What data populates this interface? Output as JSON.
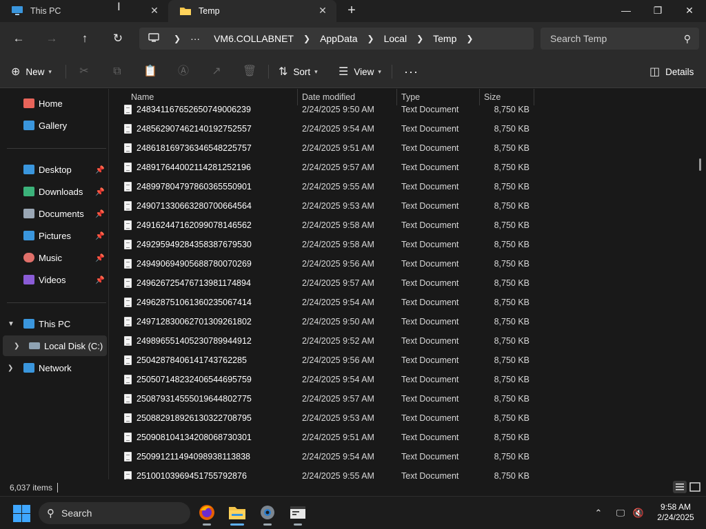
{
  "tabs": [
    {
      "label": "This PC",
      "active": false
    },
    {
      "label": "Temp",
      "active": true
    }
  ],
  "nav": {
    "breadcrumb": [
      "···",
      "VM6.COLLABNET",
      "AppData",
      "Local",
      "Temp"
    ],
    "search_placeholder": "Search Temp"
  },
  "commands": {
    "new_label": "New",
    "sort_label": "Sort",
    "view_label": "View",
    "more_label": "···",
    "details_label": "Details"
  },
  "sidebar": {
    "quick": [
      {
        "label": "Home",
        "icon": "home-icon",
        "color": "#e8645a"
      },
      {
        "label": "Gallery",
        "icon": "gallery-icon",
        "color": "#3a96dd"
      }
    ],
    "pinned": [
      {
        "label": "Desktop",
        "icon": "desktop-icon",
        "color": "#3a96dd"
      },
      {
        "label": "Downloads",
        "icon": "downloads-icon",
        "color": "#3bb27a"
      },
      {
        "label": "Documents",
        "icon": "documents-icon",
        "color": "#9aa7b5"
      },
      {
        "label": "Pictures",
        "icon": "pictures-icon",
        "color": "#3a96dd"
      },
      {
        "label": "Music",
        "icon": "music-icon",
        "color": "#e0706a"
      },
      {
        "label": "Videos",
        "icon": "videos-icon",
        "color": "#8a5cd6"
      }
    ],
    "tree": [
      {
        "label": "This PC",
        "icon": "computer-icon",
        "expanded": true
      },
      {
        "label": "Local Disk (C:)",
        "icon": "drive-icon",
        "selected": true
      },
      {
        "label": "Network",
        "icon": "network-icon",
        "expanded": false
      }
    ]
  },
  "columns": {
    "name": "Name",
    "date": "Date modified",
    "type": "Type",
    "size": "Size"
  },
  "files": [
    {
      "name": "2483411676526507490062​39",
      "date": "2/24/2025 9:50 AM",
      "type": "Text Document",
      "size": "8,750 KB"
    },
    {
      "name": "2485629074621401927525​57",
      "date": "2/24/2025 9:54 AM",
      "type": "Text Document",
      "size": "8,750 KB"
    },
    {
      "name": "2486181697363465482257​57",
      "date": "2/24/2025 9:51 AM",
      "type": "Text Document",
      "size": "8,750 KB"
    },
    {
      "name": "2489176440021142812521​96",
      "date": "2/24/2025 9:57 AM",
      "type": "Text Document",
      "size": "8,750 KB"
    },
    {
      "name": "2489978047978603655509​01",
      "date": "2/24/2025 9:55 AM",
      "type": "Text Document",
      "size": "8,750 KB"
    },
    {
      "name": "2490713306632807006645​64",
      "date": "2/24/2025 9:53 AM",
      "type": "Text Document",
      "size": "8,750 KB"
    },
    {
      "name": "2491624471620990781465​62",
      "date": "2/24/2025 9:58 AM",
      "type": "Text Document",
      "size": "8,750 KB"
    },
    {
      "name": "2492959492843583876795​30",
      "date": "2/24/2025 9:58 AM",
      "type": "Text Document",
      "size": "8,750 KB"
    },
    {
      "name": "2494906949056887800702​69",
      "date": "2/24/2025 9:56 AM",
      "type": "Text Document",
      "size": "8,750 KB"
    },
    {
      "name": "2496267254767139811748​94",
      "date": "2/24/2025 9:57 AM",
      "type": "Text Document",
      "size": "8,750 KB"
    },
    {
      "name": "2496287510613602350674​14",
      "date": "2/24/2025 9:54 AM",
      "type": "Text Document",
      "size": "8,750 KB"
    },
    {
      "name": "2497128300627013092618​02",
      "date": "2/24/2025 9:50 AM",
      "type": "Text Document",
      "size": "8,750 KB"
    },
    {
      "name": "2498965514052307899449​12",
      "date": "2/24/2025 9:52 AM",
      "type": "Text Document",
      "size": "8,750 KB"
    },
    {
      "name": "2504287840614174376228​5",
      "date": "2/24/2025 9:56 AM",
      "type": "Text Document",
      "size": "8,750 KB"
    },
    {
      "name": "2505071482324065446957​59",
      "date": "2/24/2025 9:54 AM",
      "type": "Text Document",
      "size": "8,750 KB"
    },
    {
      "name": "2508793145550196448027​75",
      "date": "2/24/2025 9:57 AM",
      "type": "Text Document",
      "size": "8,750 KB"
    },
    {
      "name": "2508829189261303227087​95",
      "date": "2/24/2025 9:53 AM",
      "type": "Text Document",
      "size": "8,750 KB"
    },
    {
      "name": "2509081041342080687303​01",
      "date": "2/24/2025 9:51 AM",
      "type": "Text Document",
      "size": "8,750 KB"
    },
    {
      "name": "2509912114940989381138​38",
      "date": "2/24/2025 9:54 AM",
      "type": "Text Document",
      "size": "8,750 KB"
    },
    {
      "name": "2510010396945175579287​6",
      "date": "2/24/2025 9:55 AM",
      "type": "Text Document",
      "size": "8,750 KB"
    }
  ],
  "status": {
    "item_count": "6,037 items"
  },
  "taskbar": {
    "search_label": "Search",
    "time": "9:58 AM",
    "date": "2/24/2025"
  }
}
